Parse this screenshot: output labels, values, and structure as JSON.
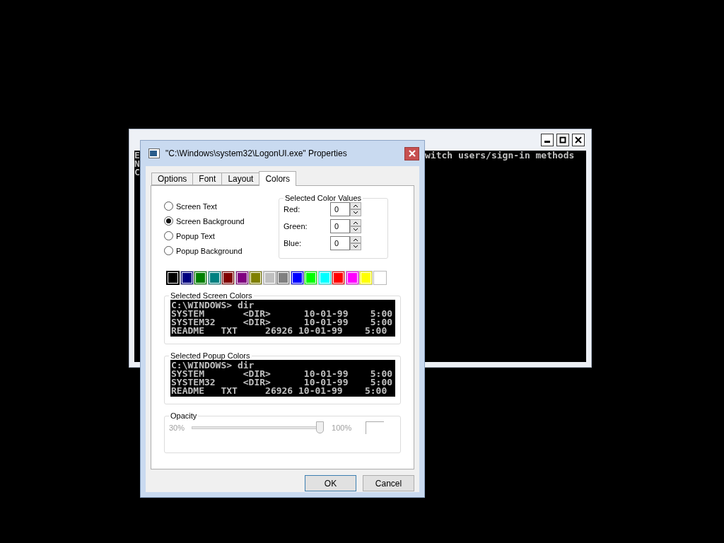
{
  "console": {
    "lines": [
      {
        "left": "E",
        "right": "witch users/sign-in methods"
      },
      {
        "left": "N"
      },
      {
        "left": "C"
      }
    ]
  },
  "dialog": {
    "title": "\"C:\\Windows\\system32\\LogonUI.exe\" Properties"
  },
  "tabs": [
    {
      "label": "Options",
      "selected": false
    },
    {
      "label": "Font",
      "selected": false
    },
    {
      "label": "Layout",
      "selected": false
    },
    {
      "label": "Colors",
      "selected": true
    }
  ],
  "color_targets": [
    {
      "label": "Screen Text",
      "selected": false
    },
    {
      "label": "Screen Background",
      "selected": true
    },
    {
      "label": "Popup Text",
      "selected": false
    },
    {
      "label": "Popup Background",
      "selected": false
    }
  ],
  "selected_color_values": {
    "title": "Selected Color Values",
    "fields": [
      {
        "label": "Red:",
        "value": "0"
      },
      {
        "label": "Green:",
        "value": "0"
      },
      {
        "label": "Blue:",
        "value": "0"
      }
    ]
  },
  "palette": [
    {
      "color": "#000000",
      "selected": true
    },
    {
      "color": "#000080",
      "selected": false
    },
    {
      "color": "#008000",
      "selected": false
    },
    {
      "color": "#008080",
      "selected": false
    },
    {
      "color": "#800000",
      "selected": false
    },
    {
      "color": "#800080",
      "selected": false
    },
    {
      "color": "#808000",
      "selected": false
    },
    {
      "color": "#c0c0c0",
      "selected": false
    },
    {
      "color": "#808080",
      "selected": false
    },
    {
      "color": "#0000ff",
      "selected": false
    },
    {
      "color": "#00ff00",
      "selected": false
    },
    {
      "color": "#00ffff",
      "selected": false
    },
    {
      "color": "#ff0000",
      "selected": false
    },
    {
      "color": "#ff00ff",
      "selected": false
    },
    {
      "color": "#ffff00",
      "selected": false
    },
    {
      "color": "#ffffff",
      "selected": false
    }
  ],
  "screen_preview": {
    "title": "Selected Screen Colors",
    "lines": [
      "C:\\WINDOWS> dir",
      "SYSTEM       <DIR>      10-01-99    5:00",
      "SYSTEM32     <DIR>      10-01-99    5:00",
      "README   TXT     26926 10-01-99    5:00"
    ]
  },
  "popup_preview": {
    "title": "Selected Popup Colors",
    "lines": [
      "C:\\WINDOWS> dir",
      "SYSTEM       <DIR>      10-01-99    5:00",
      "SYSTEM32     <DIR>      10-01-99    5:00",
      "README   TXT     26926 10-01-99    5:00"
    ]
  },
  "opacity": {
    "title": "Opacity",
    "min_label": "30%",
    "max_label": "100%",
    "level": 1,
    "disabled": true
  },
  "buttons": [
    {
      "label": "OK",
      "default": true
    },
    {
      "label": "Cancel",
      "default": false
    }
  ]
}
